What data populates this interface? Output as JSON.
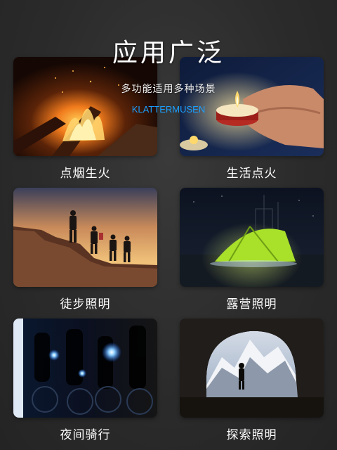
{
  "header": {
    "title": "应用广泛",
    "subtitle": "多功能适用多种场景",
    "brand": "KLATTERMUSEN"
  },
  "cards": [
    {
      "label": "点烟生火",
      "icon": "campfire-photo"
    },
    {
      "label": "生活点火",
      "icon": "candle-photo"
    },
    {
      "label": "徒步照明",
      "icon": "hikers-photo"
    },
    {
      "label": "露营照明",
      "icon": "tent-photo"
    },
    {
      "label": "夜间骑行",
      "icon": "night-cycling-photo"
    },
    {
      "label": "探索照明",
      "icon": "cave-photo"
    }
  ],
  "colors": {
    "background": "#2b2b2b",
    "brand": "#1aa0ff",
    "text": "#ffffff"
  }
}
